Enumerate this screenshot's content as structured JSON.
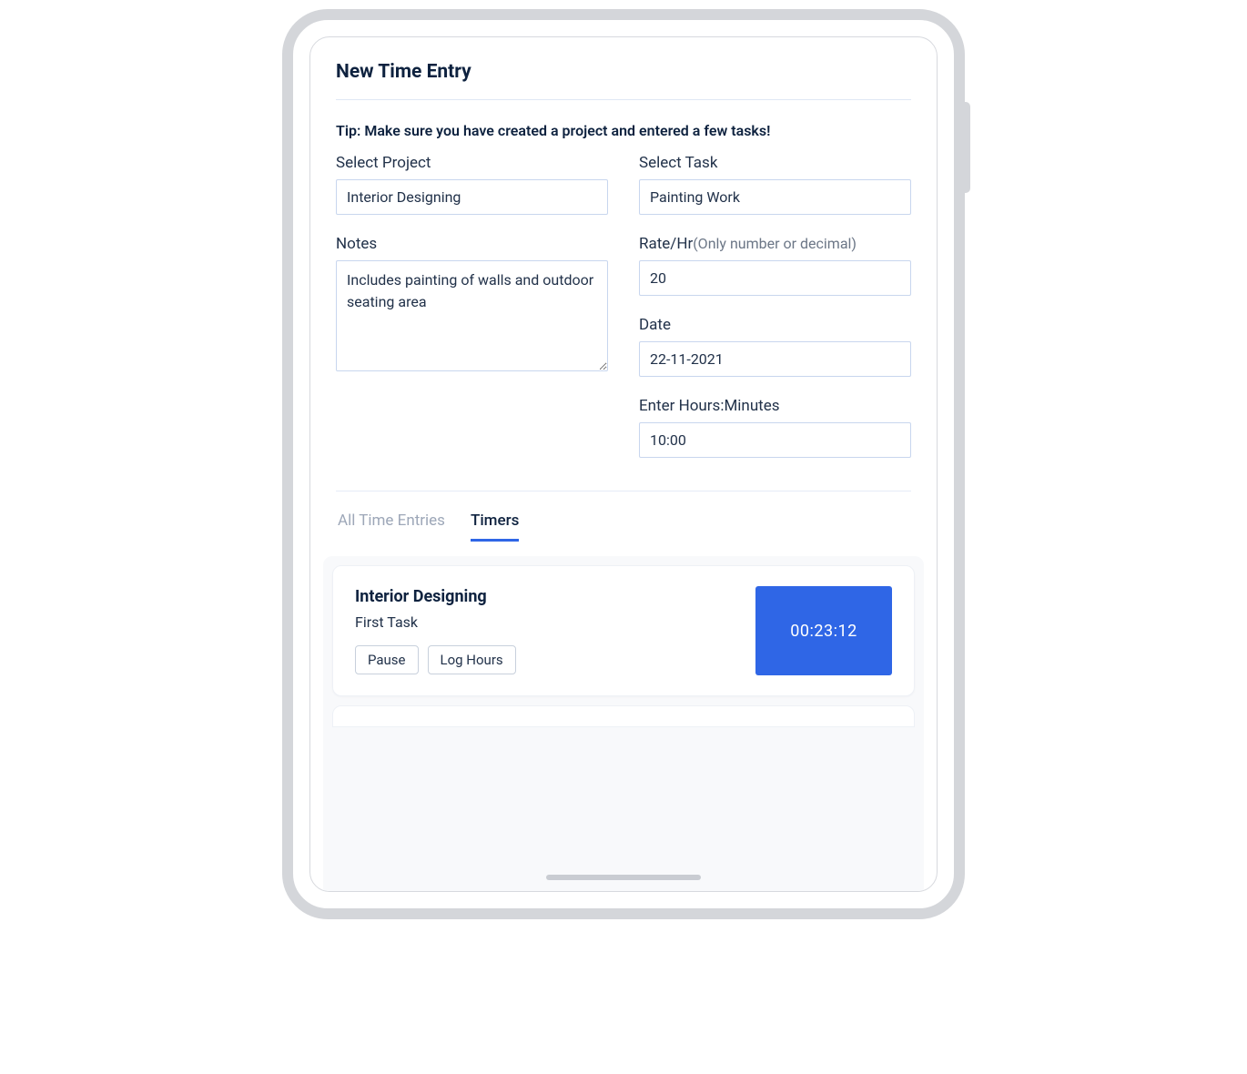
{
  "header": {
    "title": "New Time Entry"
  },
  "tip": "Tip: Make sure you have created a project and entered a few tasks!",
  "form": {
    "project_label": "Select Project",
    "project_value": "Interior Designing",
    "task_label": "Select Task",
    "task_value": "Painting Work",
    "notes_label": "Notes",
    "notes_value": "Includes painting of walls and outdoor seating area",
    "rate_label": "Rate/Hr",
    "rate_hint": "(Only number or decimal)",
    "rate_value": "20",
    "date_label": "Date",
    "date_value": "22-11-2021",
    "hours_label": "Enter Hours:Minutes",
    "hours_value": "10:00"
  },
  "tabs": {
    "all": "All Time Entries",
    "timers": "Timers"
  },
  "timer": {
    "project": "Interior Designing",
    "task": "First Task",
    "pause": "Pause",
    "log": "Log Hours",
    "elapsed": "00:23:12"
  }
}
